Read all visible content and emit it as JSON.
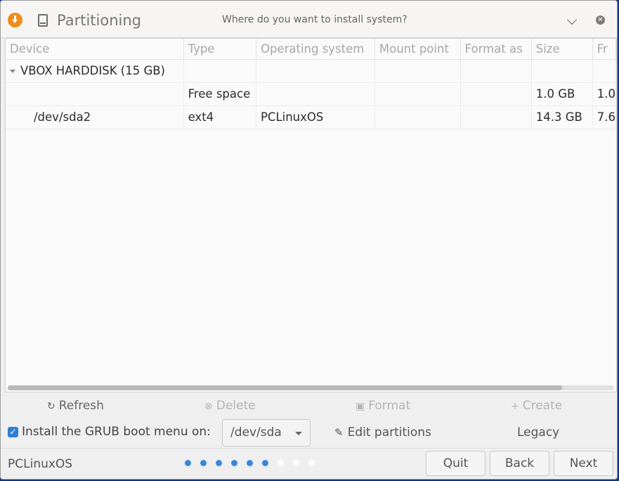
{
  "window": {
    "title": "Partitioning",
    "subtitle": "Where do you want to install system?"
  },
  "table": {
    "columns": [
      "Device",
      "Type",
      "Operating system",
      "Mount point",
      "Format as",
      "Size",
      "Fr"
    ],
    "rows": [
      {
        "device": "VBOX HARDDISK (15 GB)",
        "type": "",
        "os": "",
        "mount": "",
        "format": "",
        "size": "",
        "free": ""
      },
      {
        "device": "",
        "type": "Free space",
        "os": "",
        "mount": "",
        "format": "",
        "size": "1.0 GB",
        "free": "1.0"
      },
      {
        "device": "/dev/sda2",
        "type": "ext4",
        "os": "PCLinuxOS",
        "mount": "",
        "format": "",
        "size": "14.3 GB",
        "free": "7.6"
      }
    ]
  },
  "actions": {
    "refresh": "Refresh",
    "delete": "Delete",
    "format": "Format",
    "create": "Create"
  },
  "grub": {
    "label": "Install the GRUB boot menu on:",
    "checked": true,
    "device": "/dev/sda"
  },
  "edit_partitions": "Edit partitions",
  "boot_mode": "Legacy",
  "footer": {
    "distro": "PCLinuxOS",
    "progress": {
      "completed_steps": 6,
      "total_steps": 9
    },
    "quit": "Quit",
    "back": "Back",
    "next": "Next"
  },
  "colors": {
    "accent": "#3a86dd",
    "app_icon": "#f08c1a",
    "desktop": "#0a3a8c"
  }
}
